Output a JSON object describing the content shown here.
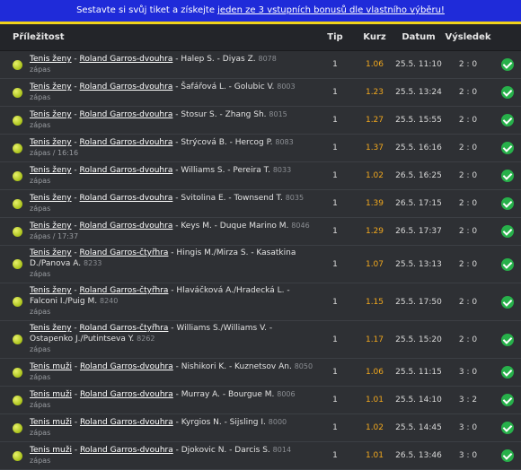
{
  "banner": {
    "text_before": "Sestavte si svůj tiket a získejte ",
    "link_text": "jeden ze 3 vstupních bonusů dle vlastního výběru!"
  },
  "header": {
    "event": "Příležitost",
    "tip": "Tip",
    "kurz": "Kurz",
    "datum": "Datum",
    "vysledek": "Výsledek"
  },
  "rows": [
    {
      "sport": "Tenis ženy",
      "tournament": "Roland Garros-dvouhra",
      "match": "Halep S. - Diyas Z.",
      "id": "8078",
      "sub": "zápas",
      "tip": "1",
      "odds": "1.06",
      "date": "25.5. 11:10",
      "result": "2 : 0",
      "tall": false
    },
    {
      "sport": "Tenis ženy",
      "tournament": "Roland Garros-dvouhra",
      "match": "Šafářová L. - Golubic V.",
      "id": "8003",
      "sub": "zápas",
      "tip": "1",
      "odds": "1.23",
      "date": "25.5. 13:24",
      "result": "2 : 0",
      "tall": false
    },
    {
      "sport": "Tenis ženy",
      "tournament": "Roland Garros-dvouhra",
      "match": "Stosur S. - Zhang Sh.",
      "id": "8015",
      "sub": "zápas",
      "tip": "1",
      "odds": "1.27",
      "date": "25.5. 15:55",
      "result": "2 : 0",
      "tall": false
    },
    {
      "sport": "Tenis ženy",
      "tournament": "Roland Garros-dvouhra",
      "match": "Strýcová B. - Hercog P.",
      "id": "8083",
      "sub": "zápas / 16:16",
      "tip": "1",
      "odds": "1.37",
      "date": "25.5. 16:16",
      "result": "2 : 0",
      "tall": false
    },
    {
      "sport": "Tenis ženy",
      "tournament": "Roland Garros-dvouhra",
      "match": "Williams S. - Pereira T.",
      "id": "8033",
      "sub": "zápas",
      "tip": "1",
      "odds": "1.02",
      "date": "26.5. 16:25",
      "result": "2 : 0",
      "tall": false
    },
    {
      "sport": "Tenis ženy",
      "tournament": "Roland Garros-dvouhra",
      "match": "Svitolina E. - Townsend T.",
      "id": "8035",
      "sub": "zápas",
      "tip": "1",
      "odds": "1.39",
      "date": "26.5. 17:15",
      "result": "2 : 0",
      "tall": false
    },
    {
      "sport": "Tenis ženy",
      "tournament": "Roland Garros-dvouhra",
      "match": "Keys M. - Duque Marino M.",
      "id": "8046",
      "sub": "zápas / 17:37",
      "tip": "1",
      "odds": "1.29",
      "date": "26.5. 17:37",
      "result": "2 : 0",
      "tall": false
    },
    {
      "sport": "Tenis ženy",
      "tournament": "Roland Garros-čtyřhra",
      "match": "Hingis M./Mirza S. - Kasatkina D./Panova A.",
      "id": "8233",
      "sub": "zápas",
      "tip": "1",
      "odds": "1.07",
      "date": "25.5. 13:13",
      "result": "2 : 0",
      "tall": true
    },
    {
      "sport": "Tenis ženy",
      "tournament": "Roland Garros-čtyřhra",
      "match": "Hlaváčková A./Hradecká L. - Falconi I./Puig M.",
      "id": "8240",
      "sub": "zápas",
      "tip": "1",
      "odds": "1.15",
      "date": "25.5. 17:50",
      "result": "2 : 0",
      "tall": true
    },
    {
      "sport": "Tenis ženy",
      "tournament": "Roland Garros-čtyřhra",
      "match": "Williams S./Williams V. - Ostapenko J./Putintseva Y.",
      "id": "8262",
      "sub": "zápas",
      "tip": "1",
      "odds": "1.17",
      "date": "25.5. 15:20",
      "result": "2 : 0",
      "tall": true
    },
    {
      "sport": "Tenis muži",
      "tournament": "Roland Garros-dvouhra",
      "match": "Nishikori K. - Kuznetsov An.",
      "id": "8050",
      "sub": "zápas",
      "tip": "1",
      "odds": "1.06",
      "date": "25.5. 11:15",
      "result": "3 : 0",
      "tall": false
    },
    {
      "sport": "Tenis muži",
      "tournament": "Roland Garros-dvouhra",
      "match": "Murray A. - Bourgue M.",
      "id": "8006",
      "sub": "zápas",
      "tip": "1",
      "odds": "1.01",
      "date": "25.5. 14:10",
      "result": "3 : 2",
      "tall": false
    },
    {
      "sport": "Tenis muži",
      "tournament": "Roland Garros-dvouhra",
      "match": "Kyrgios N. - Sijsling I.",
      "id": "8000",
      "sub": "zápas",
      "tip": "1",
      "odds": "1.02",
      "date": "25.5. 14:45",
      "result": "3 : 0",
      "tall": false
    },
    {
      "sport": "Tenis muži",
      "tournament": "Roland Garros-dvouhra",
      "match": "Djokovic N. - Darcis S.",
      "id": "8014",
      "sub": "zápas",
      "tip": "1",
      "odds": "1.01",
      "date": "26.5. 13:46",
      "result": "3 : 0",
      "tall": false
    }
  ],
  "icons": {
    "row_icon": "tennis-ball-icon",
    "result_icon": "check-circle-icon"
  },
  "colors": {
    "banner": "#1f2bd9",
    "banner_border": "#f0d21a",
    "odds": "#f2a81d",
    "check": "#27b04a"
  }
}
